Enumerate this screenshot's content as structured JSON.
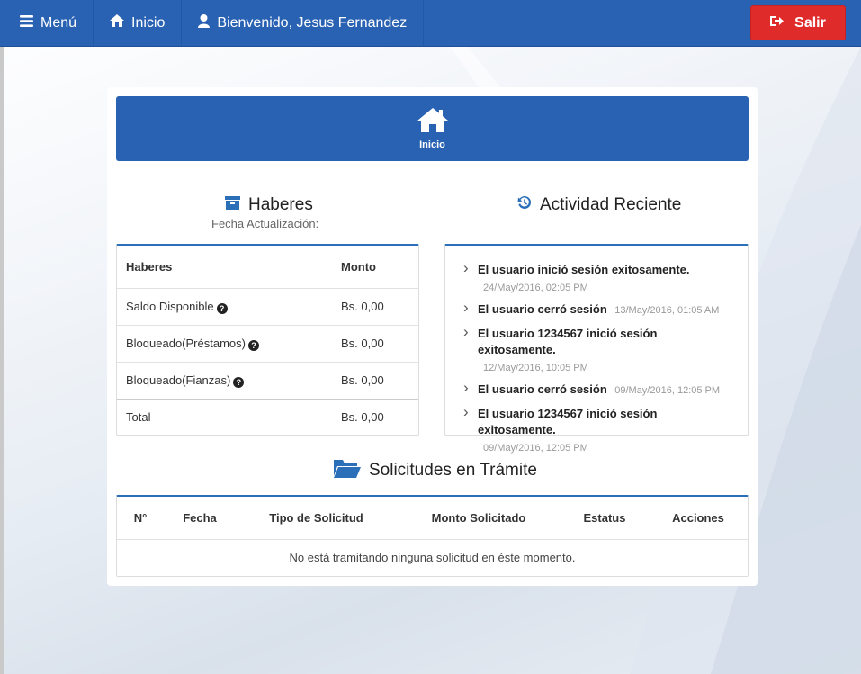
{
  "navbar": {
    "menu_label": "Menú",
    "inicio_label": "Inicio",
    "welcome_label": "Bienvenido, Jesus Fernandez",
    "logout_label": "Salir"
  },
  "hero": {
    "label": "Inicio"
  },
  "haberes": {
    "title": "Haberes",
    "subtitle": "Fecha Actualización:",
    "columns": [
      "Haberes",
      "Monto"
    ],
    "rows": [
      {
        "label": "Saldo Disponible",
        "amount": "Bs. 0,00",
        "help": true
      },
      {
        "label": "Bloqueado(Préstamos)",
        "amount": "Bs. 0,00",
        "help": true
      },
      {
        "label": "Bloqueado(Fianzas)",
        "amount": "Bs. 0,00",
        "help": true
      }
    ],
    "total": {
      "label": "Total",
      "amount": "Bs. 0,00"
    }
  },
  "actividad": {
    "title": "Actividad Reciente",
    "items": [
      {
        "message": "El usuario inició sesión exitosamente.",
        "time": "24/May/2016, 02:05 PM",
        "time_inline": false
      },
      {
        "message": "El usuario cerró sesión",
        "time": "13/May/2016, 01:05 AM",
        "time_inline": true
      },
      {
        "message": "El usuario 1234567 inició sesión exitosamente.",
        "time": "12/May/2016, 10:05 PM",
        "time_inline": false
      },
      {
        "message": "El usuario cerró sesión",
        "time": "09/May/2016, 12:05 PM",
        "time_inline": true
      },
      {
        "message": "El usuario 1234567 inició sesión exitosamente.",
        "time": "09/May/2016, 12:05 PM",
        "time_inline": false
      }
    ]
  },
  "solicitudes": {
    "title": "Solicitudes en Trámite",
    "columns": [
      "N°",
      "Fecha",
      "Tipo de Solicitud",
      "Monto Solicitado",
      "Estatus",
      "Acciones"
    ],
    "empty_message": "No está tramitando ninguna solicitud en éste momento."
  },
  "icons": {
    "menu": "bars-icon",
    "inicio": "home-icon",
    "user": "user-icon",
    "logout": "sign-out-icon",
    "haberes": "archive-icon",
    "actividad": "history-icon",
    "solicitudes": "folder-open-icon",
    "help": "question-circle-icon"
  },
  "colors": {
    "primary": "#2a62b3",
    "danger": "#e02b2b",
    "accent_border": "#2a6fb8"
  }
}
